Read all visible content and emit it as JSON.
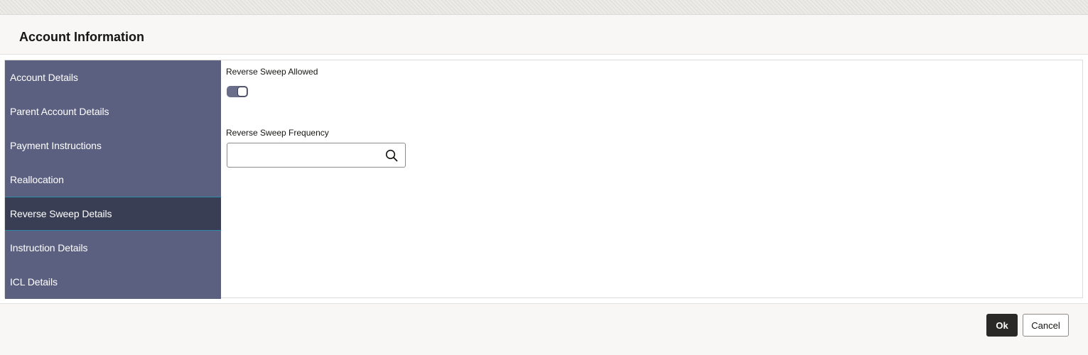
{
  "dialog": {
    "title": "Account Information"
  },
  "nav": {
    "items": [
      {
        "label": "Account Details",
        "active": false
      },
      {
        "label": "Parent Account Details",
        "active": false
      },
      {
        "label": "Payment Instructions",
        "active": false
      },
      {
        "label": "Reallocation",
        "active": false
      },
      {
        "label": "Reverse Sweep Details",
        "active": true
      },
      {
        "label": "Instruction Details",
        "active": false
      },
      {
        "label": "ICL Details",
        "active": false
      }
    ]
  },
  "form": {
    "reverse_sweep_allowed": {
      "label": "Reverse Sweep Allowed",
      "value": true
    },
    "reverse_sweep_frequency": {
      "label": "Reverse Sweep Frequency",
      "value": "",
      "icon": "search-icon"
    }
  },
  "footer": {
    "ok_label": "Ok",
    "cancel_label": "Cancel"
  },
  "colors": {
    "nav_bg": "#5c6080",
    "nav_active_bg": "#3a3e54",
    "primary_button": "#2a2927"
  }
}
